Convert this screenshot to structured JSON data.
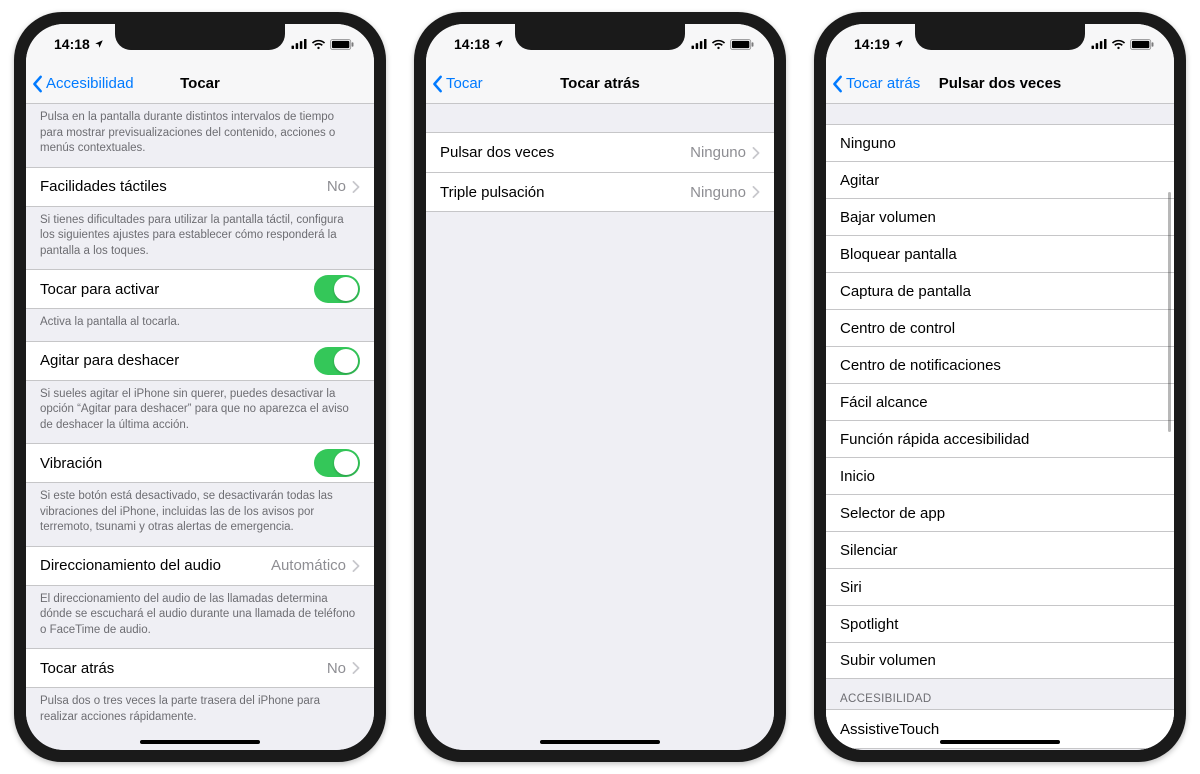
{
  "phone1": {
    "status_time": "14:18",
    "nav_back": "Accesibilidad",
    "nav_title": "Tocar",
    "intro_footer": "Pulsa en la pantalla durante distintos intervalos de tiempo para mostrar previsualizaciones del contenido, acciones o menús contextuales.",
    "row_facilidades_label": "Facilidades táctiles",
    "row_facilidades_value": "No",
    "facilidades_footer": "Si tienes dificultades para utilizar la pantalla táctil, configura los siguientes ajustes para establecer cómo responderá la pantalla a los toques.",
    "row_tocar_activar_label": "Tocar para activar",
    "tocar_activar_footer": "Activa la pantalla al tocarla.",
    "row_agitar_label": "Agitar para deshacer",
    "agitar_footer": "Si sueles agitar el iPhone sin querer, puedes desactivar la opción “Agitar para deshacer” para que no aparezca el aviso de deshacer la última acción.",
    "row_vibracion_label": "Vibración",
    "vibracion_footer": "Si este botón está desactivado, se desactivarán todas las vibraciones del iPhone, incluidas las de los avisos por terremoto, tsunami y otras alertas de emergencia.",
    "row_audio_label": "Direccionamiento del audio",
    "row_audio_value": "Automático",
    "audio_footer": "El direccionamiento del audio de las llamadas determina dónde se escuchará el audio durante una llamada de teléfono o FaceTime de audio.",
    "row_tocar_atras_label": "Tocar atrás",
    "row_tocar_atras_value": "No",
    "tocar_atras_footer": "Pulsa dos o tres veces la parte trasera del iPhone para realizar acciones rápidamente."
  },
  "phone2": {
    "status_time": "14:18",
    "nav_back": "Tocar",
    "nav_title": "Tocar atrás",
    "row_double_label": "Pulsar dos veces",
    "row_double_value": "Ninguno",
    "row_triple_label": "Triple pulsación",
    "row_triple_value": "Ninguno"
  },
  "phone3": {
    "status_time": "14:19",
    "nav_back": "Tocar atrás",
    "nav_title": "Pulsar dos veces",
    "options": [
      "Ninguno",
      "Agitar",
      "Bajar volumen",
      "Bloquear pantalla",
      "Captura de pantalla",
      "Centro de control",
      "Centro de notificaciones",
      "Fácil alcance",
      "Función rápida accesibilidad",
      "Inicio",
      "Selector de app",
      "Silenciar",
      "Siri",
      "Spotlight",
      "Subir volumen"
    ],
    "section2_header": "ACCESIBILIDAD",
    "section2_first": "AssistiveTouch"
  }
}
